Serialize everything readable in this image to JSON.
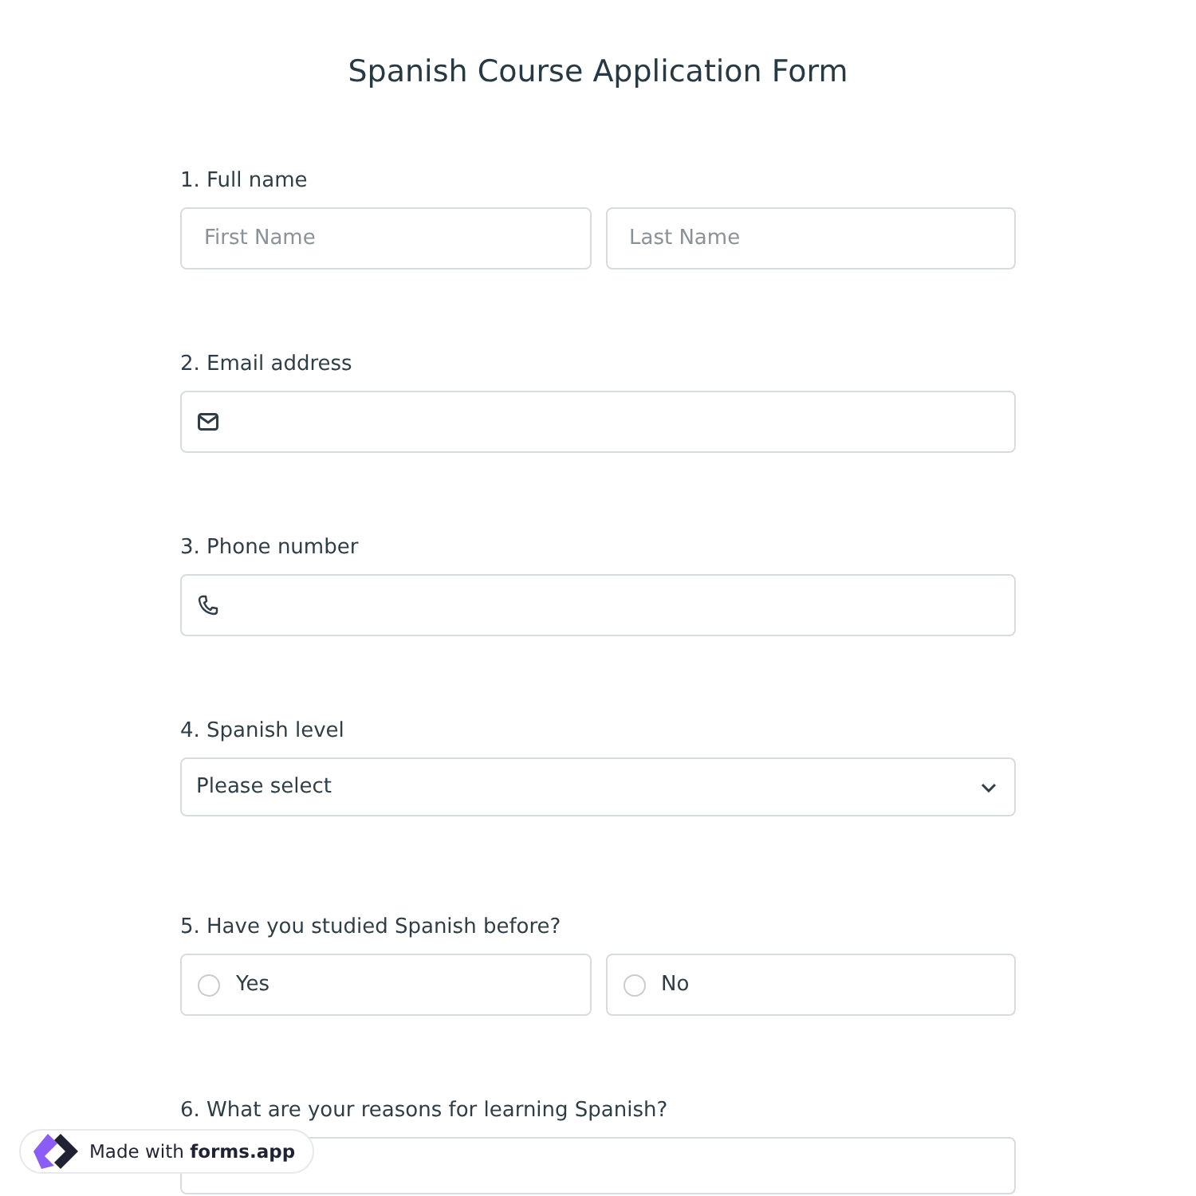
{
  "form": {
    "title": "Spanish Course Application Form"
  },
  "questions": [
    {
      "kind": "name",
      "label": "1. Full name",
      "fields": [
        {
          "placeholder": "First Name"
        },
        {
          "placeholder": "Last Name"
        }
      ]
    },
    {
      "kind": "email",
      "label": "2. Email address"
    },
    {
      "kind": "phone",
      "label": "3. Phone number"
    },
    {
      "kind": "select",
      "label": "4. Spanish level",
      "value": "Please select"
    },
    {
      "kind": "radio",
      "label": "5. Have you studied Spanish before?",
      "options": [
        {
          "label": "Yes",
          "selected": false
        },
        {
          "label": "No",
          "selected": false
        }
      ]
    },
    {
      "kind": "textarea",
      "label": "6. What are your reasons for learning Spanish?"
    }
  ],
  "badge": {
    "text": "Made with **forms.app**"
  }
}
